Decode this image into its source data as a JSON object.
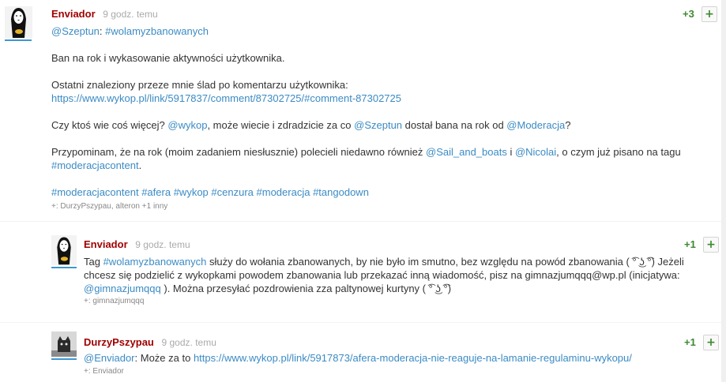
{
  "main_post": {
    "author": "Enviador",
    "time": "9 godz. temu",
    "score": "+3",
    "plus_label": "+",
    "mention": "@Szeptun",
    "mention_sep": ": ",
    "tag_main": "#wolamyzbanowanych",
    "line_ban": "Ban na rok i wykasowanie aktywności użytkownika.",
    "line_trace": "Ostatni znaleziony przeze mnie ślad po komentarzu użytkownika:",
    "trace_link": "https://www.wykop.pl/link/5917837/comment/87302725/#comment-87302725",
    "q_start": "Czy ktoś wie coś więcej? ",
    "q_wykop": "@wykop",
    "q_mid": ", może wiecie i zdradzicie za co ",
    "q_szeptun": "@Szeptun",
    "q_mid2": " dostał bana na rok od ",
    "q_moderacja": "@Moderacja",
    "q_end": "?",
    "r_start": "Przypominam, że na rok (moim zadaniem niesłusznie) polecieli niedawno również ",
    "r_sail": "@Sail_and_boats",
    "r_and": " i ",
    "r_nicolai": "@Nicolai",
    "r_mid": ", o czym już pisano na tagu",
    "r_tag": "#moderacjacontent",
    "r_end": ".",
    "tags": [
      "#moderacjacontent",
      "#afera",
      "#wykop",
      "#cenzura",
      "#moderacja",
      "#tangodown"
    ],
    "voters": "+: DurzyPszypau, alteron +1 inny"
  },
  "reply1": {
    "author": "Enviador",
    "time": "9 godz. temu",
    "score": "+1",
    "plus_label": "+",
    "text_start": "Tag ",
    "tag": "#wolamyzbanowanych",
    "text_mid": " służy do wołania zbanowanych, by nie było im smutno, bez względu na powód zbanowania ( ͡° ͜ʖ ͡°) Jeżeli chcesz się podzielić z wykopkami powodem zbanowania lub przekazać inną wiadomość, pisz na gimnazjumqqq@wp.pl (inicjatywa: ",
    "mention": "@gimnazjumqqq",
    "text_end": " ). Można przesyłać pozdrowienia zza paltynowej kurtyny ( ͡° ͜ʖ ͡°)",
    "voters": "+: gimnazjumqqq"
  },
  "reply2": {
    "author": "DurzyPszypau",
    "time": "9 godz. temu",
    "score": "+1",
    "plus_label": "+",
    "mention": "@Enviador",
    "text_mid": ": Może za to ",
    "link": "https://www.wykop.pl/link/5917873/afera-moderacja-nie-reaguje-na-lamanie-regulaminu-wykopu/",
    "voters": "+: Enviador"
  }
}
